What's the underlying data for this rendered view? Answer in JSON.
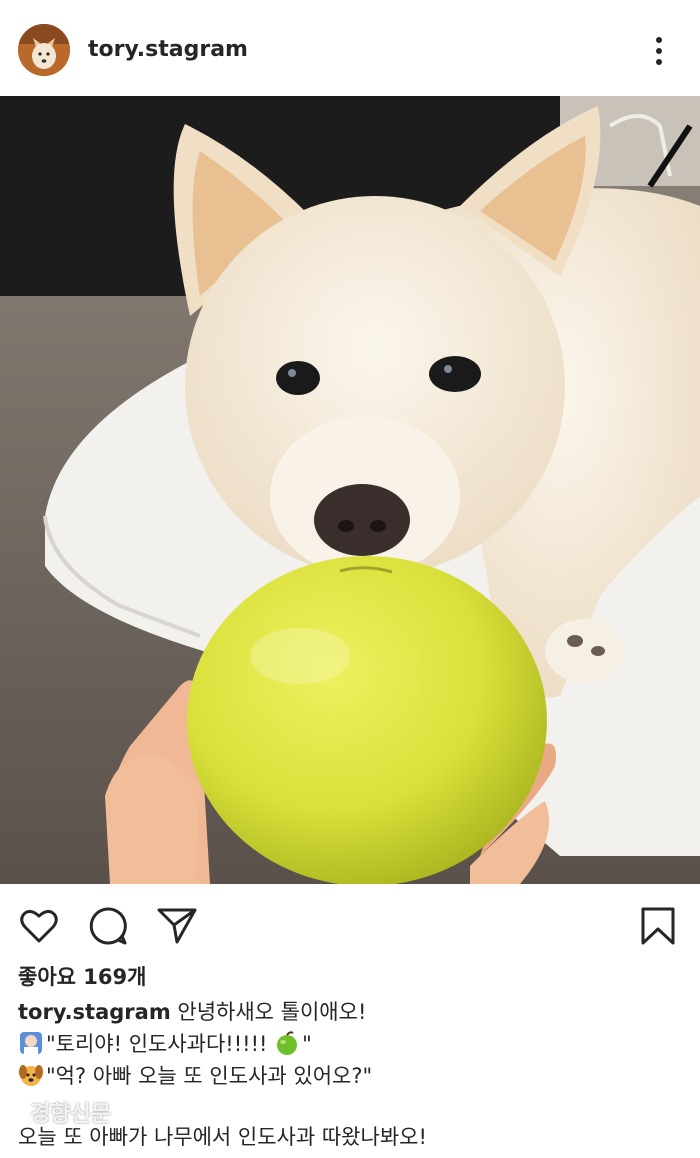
{
  "header": {
    "username": "tory.stagram",
    "avatar_icon": "dog-avatar",
    "more_icon": "more-vertical-icon"
  },
  "post": {
    "image_icon": "dog-with-apple-photo",
    "likes_text": "좋아요 169개"
  },
  "actions": {
    "like_icon": "heart-icon",
    "comment_icon": "comment-icon",
    "share_icon": "share-icon",
    "save_icon": "bookmark-icon"
  },
  "caption": {
    "username": "tory.stagram",
    "line1_text": " 안녕하새오 톨이애오!",
    "line2_text": "\"토리야! 인도사과다!!!!! ",
    "line2_end": "\"",
    "line3_text": "\"억? 아빠 오늘 또 인도사과 있어오?\"",
    "line4_text": "오늘 또 아빠가 나무에서 인도사과 따왔나봐오!"
  },
  "watermark": "경향신문",
  "colors": {
    "text": "#262626",
    "apple": "#d8e03a",
    "dog": "#f4ecdf"
  }
}
